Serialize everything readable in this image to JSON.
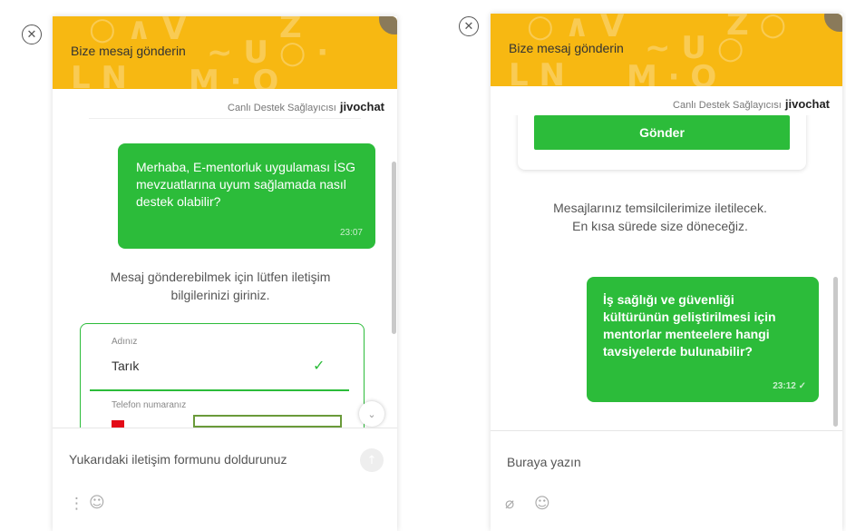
{
  "colors": {
    "header": "#f7b812",
    "accent": "#2cbc3a"
  },
  "left_widget": {
    "header_title": "Bize mesaj gönderin",
    "provider_label": "Canlı Destek Sağlayıcısı",
    "brand": "jivochat",
    "user_message": {
      "text": "Merhaba, E-mentorluk uygulaması İSG mevzuatlarına uyum sağlamada nasıl destek olabilir?",
      "time": "23:07"
    },
    "system_message": "Mesaj gönderebilmek için lütfen iletişim bilgilerinizi giriniz.",
    "form": {
      "name_label": "Adınız",
      "name_value": "Tarık",
      "phone_label": "Telefon numaranız"
    },
    "input_placeholder": "Yukarıdaki iletişim formunu doldurunuz",
    "icons": {
      "close": "close-icon",
      "menu": "more-vertical-icon",
      "emoji": "smiley-icon",
      "send": "send-arrow-icon",
      "scroll": "chevron-down-icon"
    }
  },
  "right_widget": {
    "header_title": "Bize mesaj gönderin",
    "provider_label": "Canlı Destek Sağlayıcısı",
    "brand": "jivochat",
    "send_button": "Gönder",
    "system_message": "Mesajlarınız temsilcilerimize iletilecek. En kısa sürede size döneceğiz.",
    "user_message": {
      "text": "İş sağlığı ve güvenliği kültürünün geliştirilmesi için mentorlar menteelere hangi tavsiyelerde bulunabilir?",
      "time": "23:12 ✓"
    },
    "input_placeholder": "Buraya yazın",
    "icons": {
      "close": "close-icon",
      "attach": "paperclip-icon",
      "emoji": "smiley-icon"
    }
  }
}
